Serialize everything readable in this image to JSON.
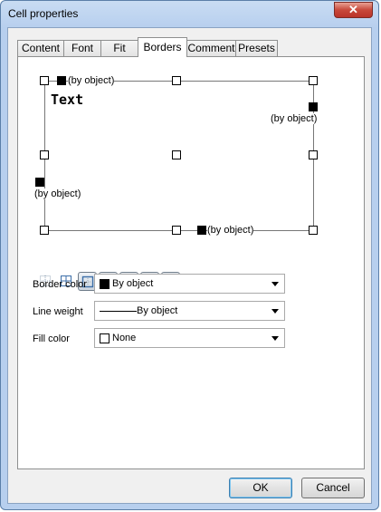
{
  "window": {
    "title": "Cell properties",
    "close_glyph": "✕"
  },
  "tabs": [
    {
      "label": "Content",
      "active": false
    },
    {
      "label": "Font",
      "active": false
    },
    {
      "label": "Fit",
      "active": false
    },
    {
      "label": "Borders",
      "active": true
    },
    {
      "label": "Comment",
      "active": false
    },
    {
      "label": "Presets",
      "active": false
    }
  ],
  "preview": {
    "sample_text": "Text",
    "top_label": "(by object)",
    "right_label": "(by object)",
    "left_label": "(by object)",
    "bottom_label": "(by object)"
  },
  "border_buttons": [
    {
      "icon": "no-border-icon",
      "selected": false
    },
    {
      "icon": "all-borders-icon",
      "selected": false
    },
    {
      "icon": "outer-border-icon",
      "selected": true
    },
    {
      "icon": "top-border-icon",
      "selected": true
    },
    {
      "icon": "bottom-border-icon",
      "selected": true
    },
    {
      "icon": "left-border-icon",
      "selected": true
    },
    {
      "icon": "right-border-icon",
      "selected": true
    },
    {
      "icon": "inner-horizontal-icon",
      "selected": false
    },
    {
      "icon": "inner-vertical-icon",
      "selected": false
    }
  ],
  "fields": {
    "border_color": {
      "label": "Border color",
      "value": "By object",
      "swatch": "#000000"
    },
    "line_weight": {
      "label": "Line weight",
      "value": "By object"
    },
    "fill_color": {
      "label": "Fill color",
      "value": "None",
      "swatch": "#ffffff"
    }
  },
  "buttons": {
    "ok": "OK",
    "cancel": "Cancel"
  }
}
